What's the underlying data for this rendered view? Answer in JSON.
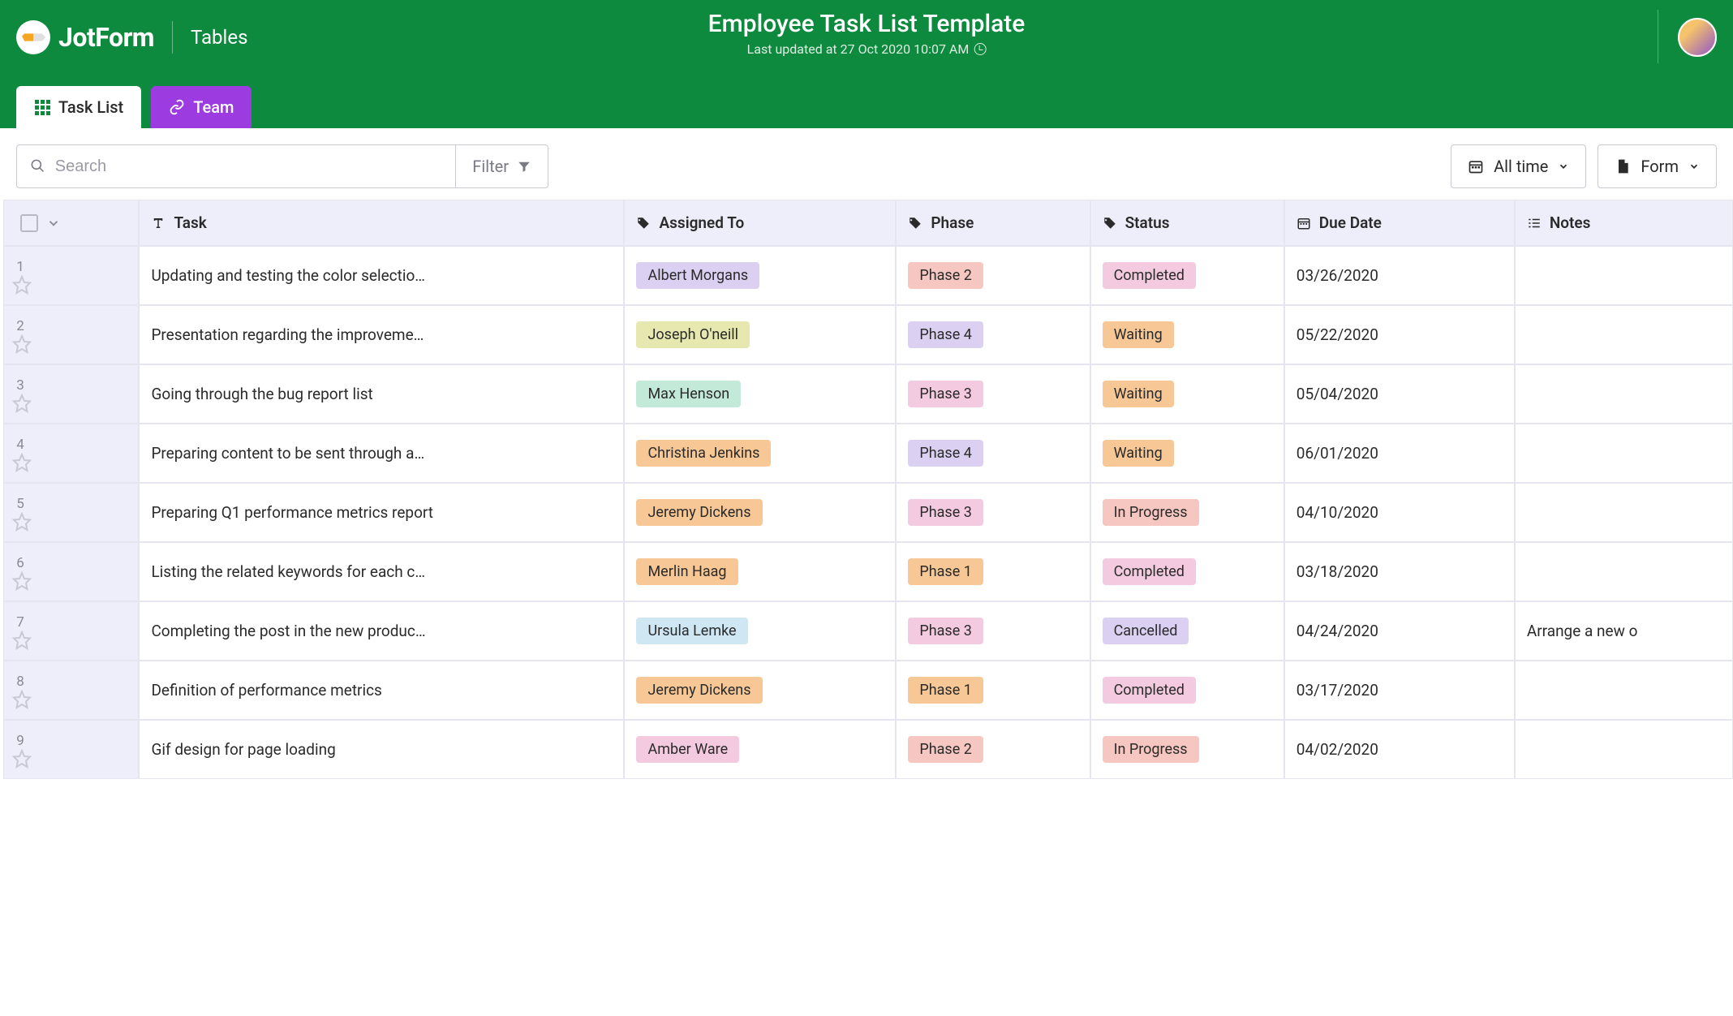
{
  "brand": {
    "app": "JotForm",
    "product": "Tables"
  },
  "header": {
    "title": "Employee Task List Template",
    "subtitle": "Last updated at 27 Oct 2020 10:07 AM"
  },
  "tabs": {
    "primary": "Task List",
    "secondary": "Team"
  },
  "toolbar": {
    "search_placeholder": "Search",
    "filter_label": "Filter",
    "range_label": "All time",
    "form_label": "Form"
  },
  "columns": {
    "task": "Task",
    "assigned": "Assigned To",
    "phase": "Phase",
    "status": "Status",
    "due": "Due Date",
    "notes": "Notes"
  },
  "palette": {
    "assignee": {
      "Albert Morgans": "#dcd0f2",
      "Joseph O'neill": "#e6e8b0",
      "Max Henson": "#c3ead9",
      "Christina Jenkins": "#f7c795",
      "Jeremy Dickens": "#f7c795",
      "Merlin Haag": "#f7c795",
      "Ursula Lemke": "#cfe7f2",
      "Amber Ware": "#f4cae0"
    },
    "phase": {
      "Phase 1": "#f7c795",
      "Phase 2": "#f6c6c0",
      "Phase 3": "#f4cae0",
      "Phase 4": "#dcd0f2"
    },
    "status": {
      "Completed": "#f4cae0",
      "Waiting": "#f7c795",
      "In Progress": "#f6c6c0",
      "Cancelled": "#dcd0f2"
    }
  },
  "rows": [
    {
      "num": "1",
      "task": "Updating and testing the color selectio…",
      "assigned": "Albert Morgans",
      "phase": "Phase 2",
      "status": "Completed",
      "due": "03/26/2020",
      "notes": ""
    },
    {
      "num": "2",
      "task": "Presentation regarding the improveme…",
      "assigned": "Joseph O'neill",
      "phase": "Phase 4",
      "status": "Waiting",
      "due": "05/22/2020",
      "notes": ""
    },
    {
      "num": "3",
      "task": "Going through the bug report list",
      "assigned": "Max Henson",
      "phase": "Phase 3",
      "status": "Waiting",
      "due": "05/04/2020",
      "notes": ""
    },
    {
      "num": "4",
      "task": "Preparing content to be sent through a…",
      "assigned": "Christina Jenkins",
      "phase": "Phase 4",
      "status": "Waiting",
      "due": "06/01/2020",
      "notes": ""
    },
    {
      "num": "5",
      "task": "Preparing Q1 performance metrics report",
      "assigned": "Jeremy Dickens",
      "phase": "Phase 3",
      "status": "In Progress",
      "due": "04/10/2020",
      "notes": ""
    },
    {
      "num": "6",
      "task": "Listing the related keywords for each c…",
      "assigned": "Merlin Haag",
      "phase": "Phase 1",
      "status": "Completed",
      "due": "03/18/2020",
      "notes": ""
    },
    {
      "num": "7",
      "task": "Completing the post in the new produc…",
      "assigned": "Ursula Lemke",
      "phase": "Phase 3",
      "status": "Cancelled",
      "due": "04/24/2020",
      "notes": "Arrange a new o"
    },
    {
      "num": "8",
      "task": "Definition of performance metrics",
      "assigned": "Jeremy Dickens",
      "phase": "Phase 1",
      "status": "Completed",
      "due": "03/17/2020",
      "notes": ""
    },
    {
      "num": "9",
      "task": "Gif design for page loading",
      "assigned": "Amber Ware",
      "phase": "Phase 2",
      "status": "In Progress",
      "due": "04/02/2020",
      "notes": ""
    }
  ]
}
